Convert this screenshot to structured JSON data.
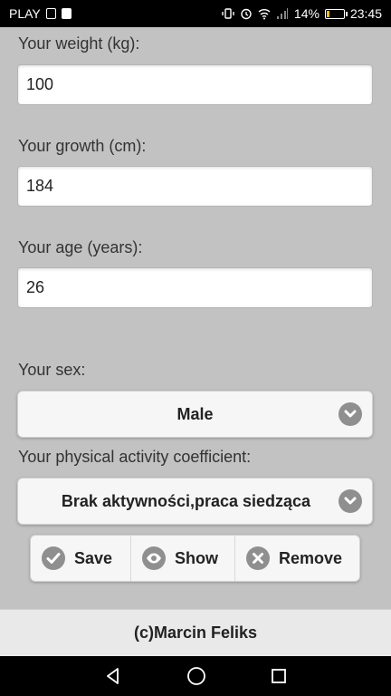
{
  "status_bar": {
    "carrier": "PLAY",
    "battery_percent": "14%",
    "time": "23:45",
    "battery_level": 0.14,
    "icons": [
      "sim-icon",
      "facebook-icon",
      "vibrate-icon",
      "alarm-icon",
      "wifi-icon",
      "signal-icon",
      "battery-icon"
    ]
  },
  "form": {
    "weight_label": "Your weight (kg):",
    "weight_value": "100",
    "growth_label": "Your growth (cm):",
    "growth_value": "184",
    "age_label": "Your age (years):",
    "age_value": "26",
    "sex_label": "Your sex:",
    "sex_value": "Male",
    "activity_label": "Your physical activity coefficient:",
    "activity_value": "Brak aktywności,praca siedząca"
  },
  "actions": {
    "save_label": "Save",
    "show_label": "Show",
    "remove_label": "Remove"
  },
  "footer": {
    "text": "(c)Marcin Feliks"
  },
  "colors": {
    "background": "#c2c2c2",
    "icon_circle": "#8f8f8f",
    "footer": "#e9e9e9"
  }
}
